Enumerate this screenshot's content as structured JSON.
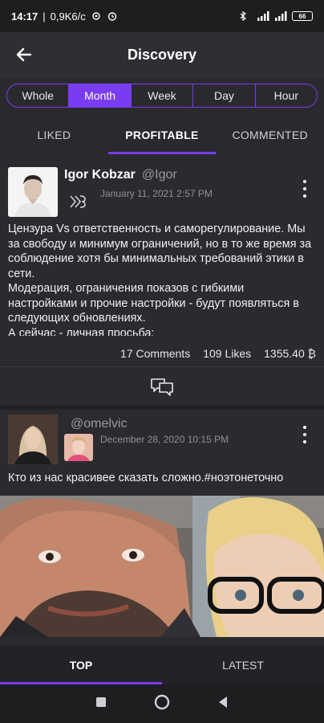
{
  "status_bar": {
    "time": "14:17",
    "speed": "0,9K6/c",
    "battery": "66"
  },
  "header": {
    "title": "Discovery"
  },
  "period_filter": {
    "options": [
      "Whole",
      "Month",
      "Week",
      "Day",
      "Hour"
    ],
    "selected": "Month"
  },
  "tabs": {
    "items": [
      "LIKED",
      "PROFITABLE",
      "COMMENTED"
    ],
    "active": "PROFITABLE"
  },
  "posts": [
    {
      "author": "Igor Kobzar",
      "handle": "@Igor",
      "date": "January 11, 2021 2:57 PM",
      "text": "Цензура Vs ответственность и саморегулирование. Мы за свободу и минимум ограничений, но в то же время за соблюдение хотя бы минимальных требований этики в сети.\nМодерация, ограничения показов с гибкими настройками и прочие настройки - будут появляться в следующих обновлениях.\nА сейчас - личная просьба:",
      "comments": "17 Comments",
      "likes": "109 Likes",
      "earnings": "1355.40 ₿"
    },
    {
      "author": "",
      "handle": "@omelvic",
      "date": "December 28, 2020 10:15 PM",
      "text": "Кто из нас красивее сказать сложно.#ноэтонеточно"
    }
  ],
  "bottom_tabs": {
    "items": [
      "TOP",
      "LATEST"
    ],
    "active": "TOP"
  },
  "colors": {
    "accent": "#7a3cf0",
    "background": "#2a2a2e"
  }
}
